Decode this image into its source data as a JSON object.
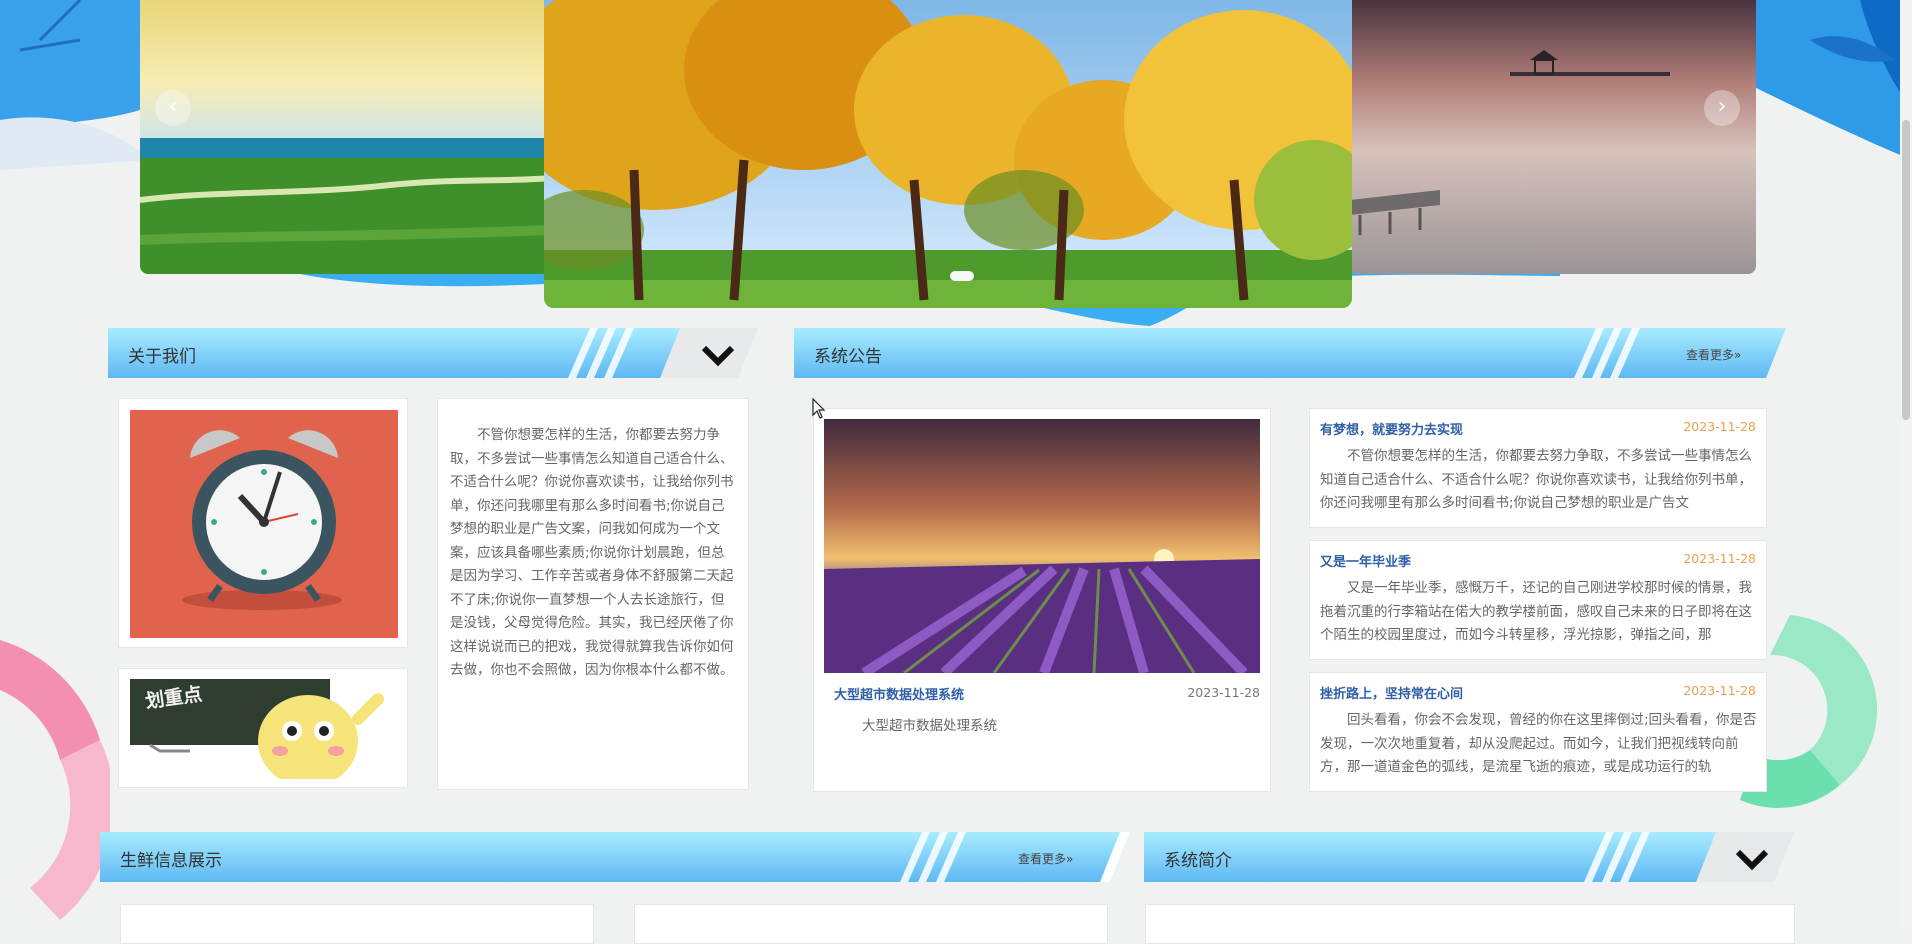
{
  "carousel": {
    "prev_arrow": "‹",
    "next_arrow": "›",
    "slides": [
      "grassland-lake-slide",
      "autumn-trees-slide",
      "calm-sea-pier-slide"
    ],
    "active_index": 1
  },
  "about": {
    "title": "关于我们",
    "text": "不管你想要怎样的生活，你都要去努力争取，不多尝试一些事情怎么知道自己适合什么、不适合什么呢？你说你喜欢读书，让我给你列书单，你还问我哪里有那么多时间看书;你说自己梦想的职业是广告文案，问我如何成为一个文案，应该具备哪些素质;你说你计划晨跑，但总是因为学习、工作辛苦或者身体不舒服第二天起不了床;你说你一直梦想一个人去长途旅行，但是没钱，父母觉得危险。其实，我已经厌倦了你这样说说而已的把戏，我觉得就算我告诉你如何去做，你也不会照做，因为你根本什么都不做。",
    "cartoon_board_text": "划重点"
  },
  "notices": {
    "title": "系统公告",
    "more_label": "查看更多»",
    "featured": {
      "title": "大型超市数据处理系统",
      "date": "2023-11-28",
      "body": "大型超市数据处理系统"
    },
    "items": [
      {
        "title": "有梦想，就要努力去实现",
        "date": "2023-11-28",
        "body": "不管你想要怎样的生活，你都要去努力争取，不多尝试一些事情怎么知道自己适合什么、不适合什么呢？你说你喜欢读书，让我给你列书单，你还问我哪里有那么多时间看书;你说自己梦想的职业是广告文"
      },
      {
        "title": "又是一年毕业季",
        "date": "2023-11-28",
        "body": "又是一年毕业季，感慨万千，还记的自己刚进学校那时候的情景，我拖着沉重的行李箱站在偌大的教学楼前面，感叹自己未来的日子即将在这个陌生的校园里度过，而如今斗转星移，浮光掠影，弹指之间，那"
      },
      {
        "title": "挫折路上，坚持常在心间",
        "date": "2023-11-28",
        "body": "回头看看，你会不会发现，曾经的你在这里摔倒过;回头看看，你是否发现，一次次地重复着，却从没爬起过。而如今，让我们把视线转向前方，那一道道金色的弧线，是流星飞逝的痕迹，或是成功运行的轨"
      }
    ]
  },
  "fresh": {
    "title": "生鲜信息展示",
    "more_label": "查看更多»"
  },
  "intro": {
    "title": "系统简介"
  },
  "colors": {
    "header_light": "#a8ecff",
    "header_main": "#5fc0f5",
    "title_blue": "#2f5fa8",
    "date_orange": "#e8a050"
  }
}
